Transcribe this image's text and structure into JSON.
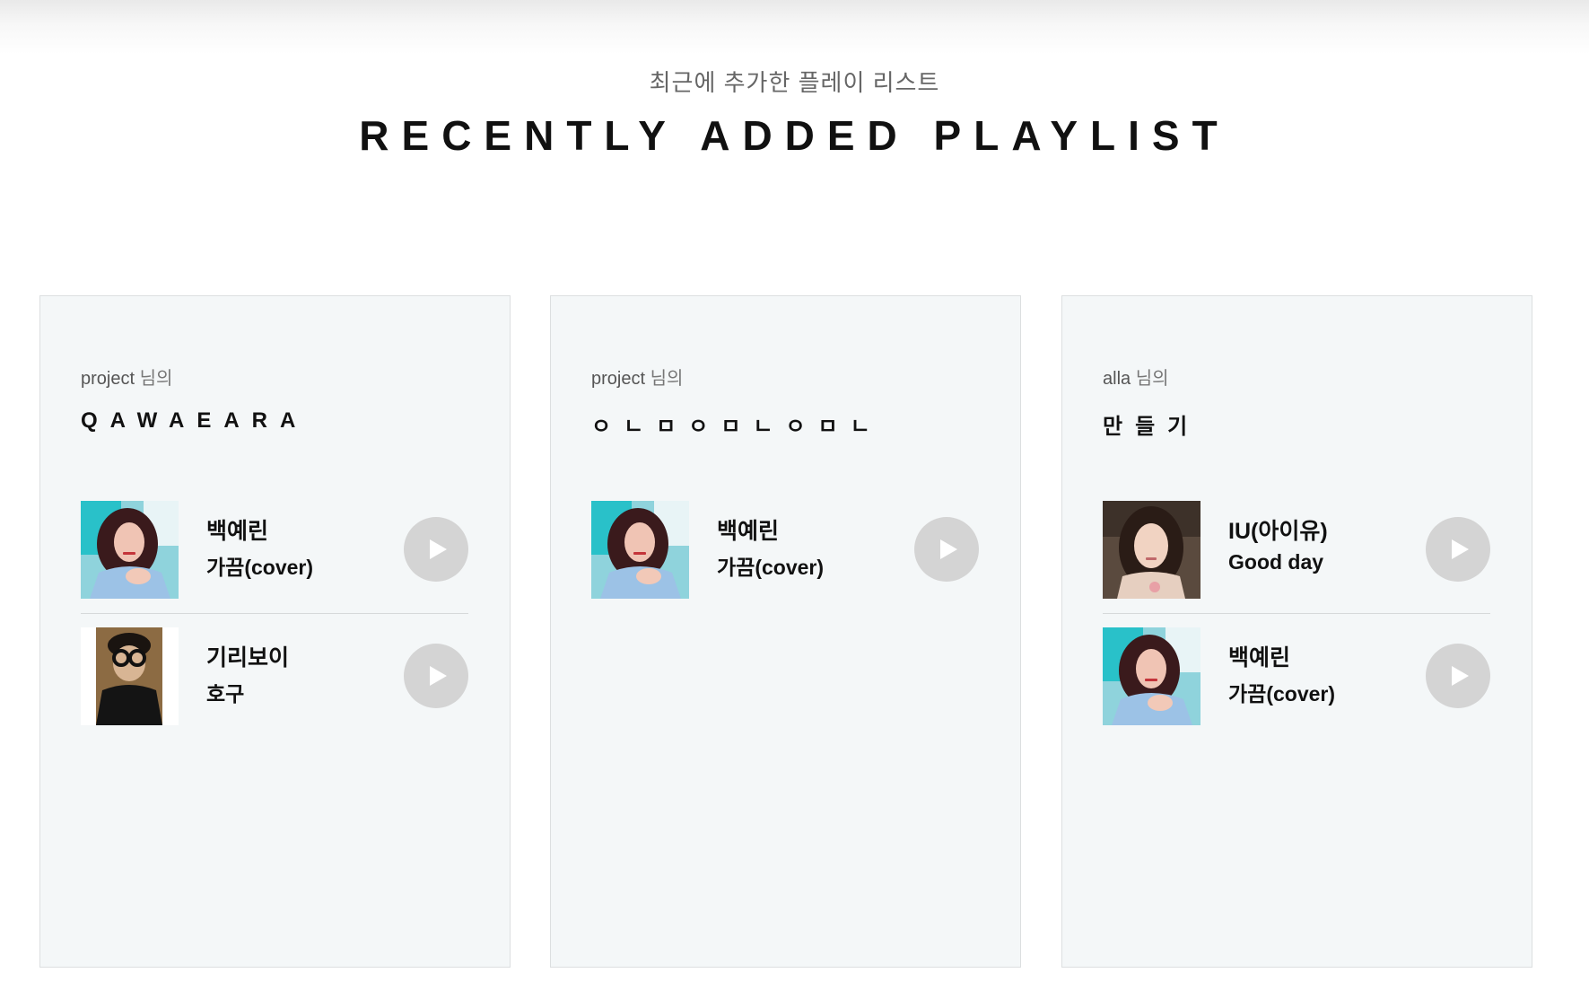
{
  "header": {
    "subtitle": "최근에 추가한 플레이 리스트",
    "title": "RECENTLY ADDED PLAYLIST"
  },
  "playlists": [
    {
      "owner": "project",
      "owner_suffix": "님의",
      "title": "QAWAEARA",
      "tracks": [
        {
          "artist": "백예린",
          "song": "가끔(cover)",
          "thumb": "baek-yerin-photo",
          "play_icon": "play-icon"
        },
        {
          "artist": "기리보이",
          "song": "호구",
          "thumb": "giriboy-photo",
          "play_icon": "play-icon"
        }
      ]
    },
    {
      "owner": "project",
      "owner_suffix": "님의",
      "title": "ㅇㄴㅁㅇㅁㄴㅇㅁㄴ",
      "tracks": [
        {
          "artist": "백예린",
          "song": "가끔(cover)",
          "thumb": "baek-yerin-photo",
          "play_icon": "play-icon"
        }
      ]
    },
    {
      "owner": "alla",
      "owner_suffix": "님의",
      "title": "만들기",
      "tracks": [
        {
          "artist": "IU(아이유)",
          "song": "Good day",
          "thumb": "iu-photo",
          "play_icon": "play-icon"
        },
        {
          "artist": "백예린",
          "song": "가끔(cover)",
          "thumb": "baek-yerin-photo",
          "play_icon": "play-icon"
        }
      ]
    }
  ],
  "colors": {
    "card_bg": "#f4f7f8",
    "card_border": "#dcdfe0",
    "play_button": "#d4d4d4",
    "text_primary": "#111111",
    "text_secondary": "#666666"
  }
}
